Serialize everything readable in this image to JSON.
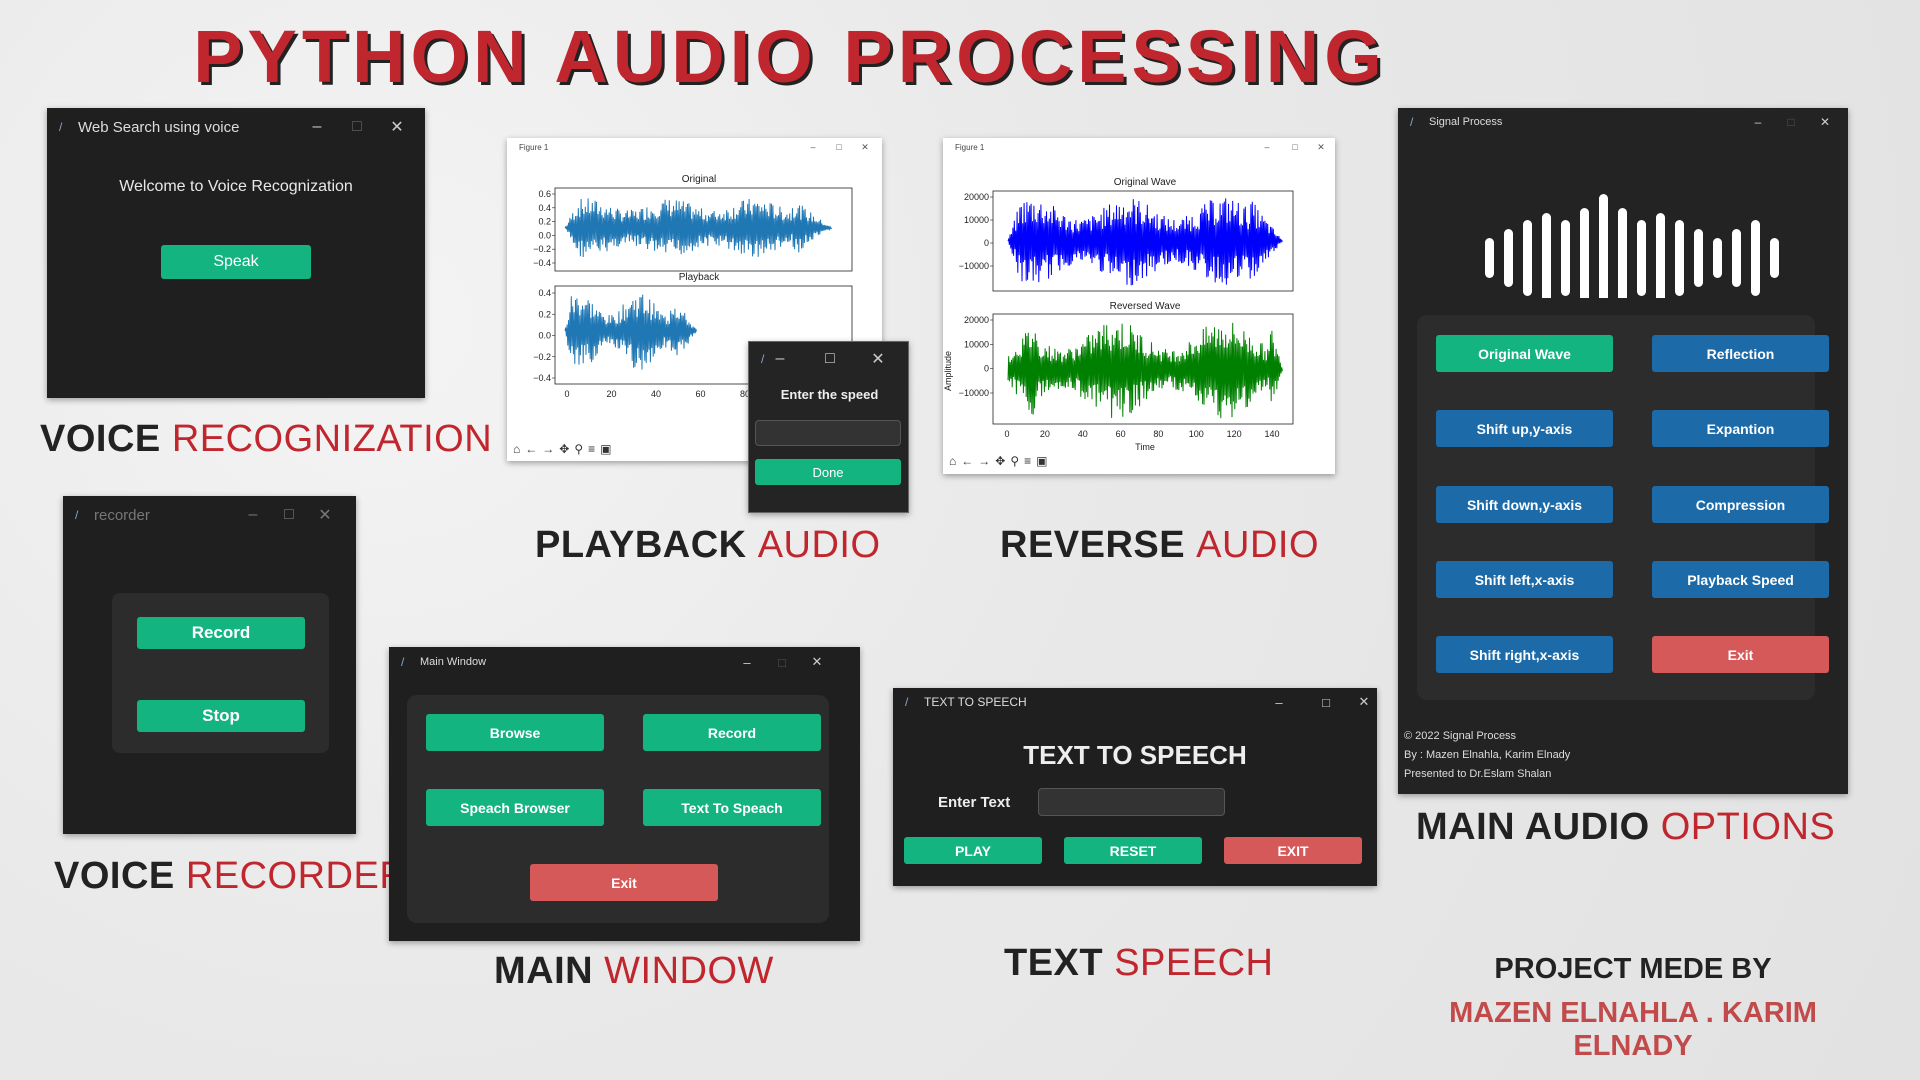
{
  "heading": "PYTHON AUDIO PROCESSING",
  "colors": {
    "green": "#14b481",
    "blue": "#1c6aa8",
    "red": "#d55959",
    "accent_text": "#c0262d"
  },
  "voice_recog": {
    "title": "Web Search using voice",
    "welcome": "Welcome to Voice Recognization",
    "speak": "Speak",
    "label_a": "VOICE ",
    "label_b": "RECOGNIZATION"
  },
  "playback": {
    "fig_title": "Figure 1",
    "plot1_title": "Original",
    "plot1_yticks": [
      "0.6",
      "0.4",
      "0.2",
      "0.0",
      "−0.2",
      "−0.4"
    ],
    "plot2_title": "Playback",
    "plot2_yticks": [
      "0.4",
      "0.2",
      "0.0",
      "−0.2",
      "−0.4"
    ],
    "xticks": [
      "0",
      "20",
      "40",
      "60",
      "80"
    ],
    "dialog_prompt": "Enter the speed",
    "dialog_input": "",
    "dialog_done": "Done",
    "label_a": "PLAYBACK ",
    "label_b": "AUDIO"
  },
  "reverse": {
    "fig_title": "Figure 1",
    "plot1_title": "Original Wave",
    "plot1_yticks": [
      "20000",
      "10000",
      "0",
      "−10000"
    ],
    "plot2_title": "Reversed Wave",
    "plot2_yticks": [
      "20000",
      "10000",
      "0",
      "−10000"
    ],
    "xticks": [
      "0",
      "20",
      "40",
      "60",
      "80",
      "100",
      "120",
      "140"
    ],
    "xlabel": "Time",
    "ylabel": "Amplitude",
    "label_a": "REVERSE ",
    "label_b": "AUDIO"
  },
  "signal": {
    "title": "Signal Process",
    "left_buttons": [
      "Original Wave",
      "Shift up,y-axis",
      "Shift down,y-axis",
      "Shift left,x-axis",
      "Shift right,x-axis"
    ],
    "right_buttons": [
      "Reflection",
      "Expantion",
      "Compression",
      "Playback Speed",
      "Exit"
    ],
    "copyright": "© 2022 Signal Process",
    "by": "By : Mazen Elnahla, Karim Elnady",
    "presented": "Presented to Dr.Eslam Shalan",
    "label_a": "MAIN AUDIO ",
    "label_b": "OPTIONS"
  },
  "recorder": {
    "title": "recorder",
    "record": "Record",
    "stop": "Stop",
    "label_a": "VOICE ",
    "label_b": "RECORDER"
  },
  "main_window": {
    "title": "Main Window",
    "browse": "Browse",
    "record": "Record",
    "speech_browser": "Speach Browser",
    "text_to_speech": "Text To Speach",
    "exit": "Exit",
    "label_a": "MAIN ",
    "label_b": "WINDOW"
  },
  "tts": {
    "title": "TEXT TO SPEECH",
    "heading": "TEXT TO SPEECH",
    "enter_text": "Enter Text",
    "input_value": "",
    "play": "PLAY",
    "reset": "RESET",
    "exit": "EXIT",
    "label_a": "TEXT ",
    "label_b": "SPEECH"
  },
  "credits": {
    "line1": "PROJECT MEDE BY",
    "line2": "MAZEN ELNAHLA . KARIM ELNADY"
  }
}
